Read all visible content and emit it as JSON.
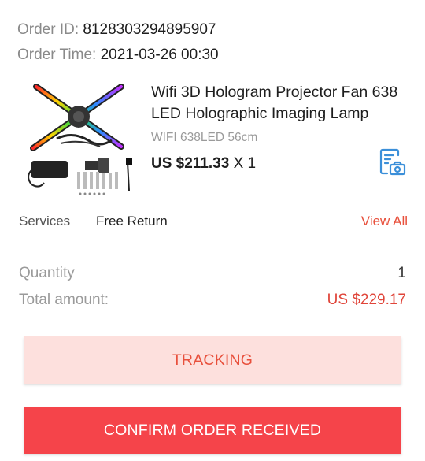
{
  "order": {
    "id_label": "Order ID:",
    "id_value": "8128303294895907",
    "time_label": "Order Time:",
    "time_value": "2021-03-26 00:30"
  },
  "product": {
    "title": "Wifi 3D Hologram Projector Fan 638 LED Holographic Imaging Lamp",
    "sku": "WIFI 638LED 56cm",
    "price": "US $211.33",
    "multiplier": "X 1",
    "image_icon": "hologram-fan-product-image",
    "snapshot_icon": "snapshot-icon"
  },
  "services": {
    "label": "Services",
    "value": "Free Return",
    "view_all": "View All"
  },
  "summary": {
    "quantity_label": "Quantity",
    "quantity_value": "1",
    "total_label": "Total amount:",
    "total_value": "US $229.17"
  },
  "buttons": {
    "tracking": "TRACKING",
    "confirm": "CONFIRM ORDER RECEIVED"
  },
  "colors": {
    "accent": "#e8503c",
    "confirm_bg": "#f5444a",
    "tracking_bg": "#fde0dd",
    "icon_blue": "#3b8fd9"
  }
}
